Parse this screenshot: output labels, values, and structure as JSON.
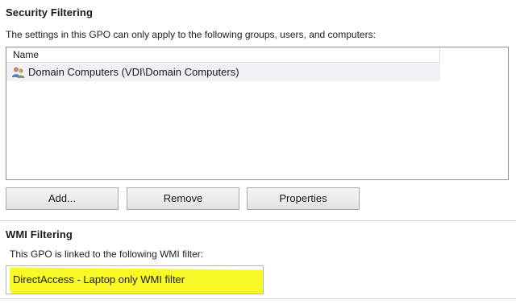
{
  "security_filtering": {
    "title": "Security Filtering",
    "description": "The settings in this GPO can only apply to the following groups, users, and computers:",
    "list": {
      "column_header": "Name",
      "items": [
        {
          "icon": "user-group-icon",
          "label": "Domain Computers (VDI\\Domain Computers)"
        }
      ]
    },
    "buttons": {
      "add": "Add...",
      "remove": "Remove",
      "properties": "Properties"
    }
  },
  "wmi_filtering": {
    "title": "WMI Filtering",
    "description": "This GPO is linked to the following WMI filter:",
    "selected_filter": "DirectAccess - Laptop only WMI filter",
    "highlight_color": "#f9f91c"
  }
}
